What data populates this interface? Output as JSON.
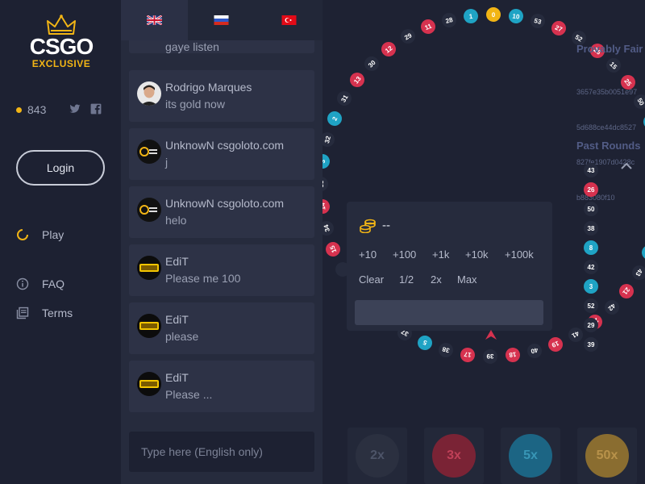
{
  "brand": {
    "main": "CSGO",
    "sub": "EXCLUSIVE"
  },
  "user": {
    "balance": "843"
  },
  "sidebar": {
    "login_label": "Login",
    "nav": [
      {
        "label": "Play",
        "icon": "spinner-icon"
      },
      {
        "label": "FAQ",
        "icon": "info-icon"
      },
      {
        "label": "Terms",
        "icon": "document-icon"
      }
    ]
  },
  "languages": [
    {
      "code": "en",
      "icon": "uk-flag-icon"
    },
    {
      "code": "ru",
      "icon": "russia-flag-icon"
    },
    {
      "code": "tr",
      "icon": "turkey-flag-icon"
    }
  ],
  "chat": {
    "partial_top_text": "gaye listen",
    "messages": [
      {
        "user": "Rodrigo Marques",
        "text": "its gold now",
        "avatar": "photo"
      },
      {
        "user": "UnknowN csgoloto.com",
        "text": "j",
        "avatar": "csgoloto"
      },
      {
        "user": "UnknowN csgoloto.com",
        "text": "helo",
        "avatar": "csgoloto"
      },
      {
        "user": "EdiT",
        "text": "Please me 100",
        "avatar": "edit"
      },
      {
        "user": "EdiT",
        "text": "please",
        "avatar": "edit"
      },
      {
        "user": "EdiT",
        "text": "Please ...",
        "avatar": "edit"
      }
    ],
    "input_placeholder": "Type here (English only)"
  },
  "provably_fair": {
    "title": "Provably Fair",
    "hash_lines": [
      "3657e35b0051e97",
      "5d688ce44dc8527",
      "827fe1907d0428c",
      "b883080f10"
    ]
  },
  "past_rounds": {
    "title": "Past Rounds",
    "values": [
      {
        "n": "43",
        "color": "#262b3d"
      },
      {
        "n": "26",
        "color": "#d6324f"
      },
      {
        "n": "50",
        "color": "#262b3d"
      },
      {
        "n": "38",
        "color": "#262b3d"
      },
      {
        "n": "8",
        "color": "#1fa3c4"
      },
      {
        "n": "42",
        "color": "#262b3d"
      },
      {
        "n": "3",
        "color": "#1fa3c4"
      },
      {
        "n": "52",
        "color": "#262b3d"
      },
      {
        "n": "29",
        "color": "#262b3d"
      },
      {
        "n": "39",
        "color": "#262b3d"
      }
    ]
  },
  "wheel": {
    "balls": [
      {
        "n": "1",
        "color": "#1fa3c4"
      },
      {
        "n": "0",
        "color": "#f2b515"
      },
      {
        "n": "10",
        "color": "#1fa3c4"
      },
      {
        "n": "53",
        "color": "#262b3d"
      },
      {
        "n": "27",
        "color": "#d6324f"
      },
      {
        "n": "52",
        "color": "#262b3d"
      },
      {
        "n": "26",
        "color": "#d6324f"
      },
      {
        "n": "15",
        "color": "#262b3d"
      },
      {
        "n": "25",
        "color": "#d6324f"
      },
      {
        "n": "50",
        "color": "#262b3d"
      },
      {
        "n": "6",
        "color": "#1fa3c4"
      },
      {
        "n": "49",
        "color": "#262b3d"
      },
      {
        "n": "",
        "color": "#1fa3c4"
      },
      {
        "n": "",
        "color": "#262b3d"
      },
      {
        "n": "",
        "color": "#262b3d"
      },
      {
        "n": "",
        "color": "#262b3d"
      },
      {
        "n": "6",
        "color": "#1fa3c4"
      },
      {
        "n": "43",
        "color": "#262b3d"
      },
      {
        "n": "21",
        "color": "#d6324f"
      },
      {
        "n": "42",
        "color": "#262b3d"
      },
      {
        "n": "20",
        "color": "#d6324f"
      },
      {
        "n": "41",
        "color": "#262b3d"
      },
      {
        "n": "19",
        "color": "#d6324f"
      },
      {
        "n": "40",
        "color": "#262b3d"
      },
      {
        "n": "18",
        "color": "#d6324f"
      },
      {
        "n": "39",
        "color": "#262b3d"
      },
      {
        "n": "17",
        "color": "#d6324f"
      },
      {
        "n": "38",
        "color": "#262b3d"
      },
      {
        "n": "5",
        "color": "#1fa3c4"
      },
      {
        "n": "37",
        "color": "#262b3d"
      },
      {
        "n": "",
        "color": "#1fa3c4"
      },
      {
        "n": "",
        "color": "#262b3d"
      },
      {
        "n": "",
        "color": "#d6324f"
      },
      {
        "n": "",
        "color": "#262b3d"
      },
      {
        "n": "15",
        "color": "#d6324f"
      },
      {
        "n": "34",
        "color": "#262b3d"
      },
      {
        "n": "14",
        "color": "#d6324f"
      },
      {
        "n": "33",
        "color": "#262b3d"
      },
      {
        "n": "3",
        "color": "#1fa3c4"
      },
      {
        "n": "32",
        "color": "#262b3d"
      },
      {
        "n": "2",
        "color": "#1fa3c4"
      },
      {
        "n": "31",
        "color": "#262b3d"
      },
      {
        "n": "13",
        "color": "#d6324f"
      },
      {
        "n": "30",
        "color": "#262b3d"
      },
      {
        "n": "12",
        "color": "#d6324f"
      },
      {
        "n": "29",
        "color": "#262b3d"
      },
      {
        "n": "11",
        "color": "#d6324f"
      },
      {
        "n": "28",
        "color": "#262b3d"
      }
    ]
  },
  "bet": {
    "amount": "--",
    "quick_buttons": [
      "+10",
      "+100",
      "+1k",
      "+10k",
      "+100k"
    ],
    "modifier_buttons": [
      "Clear",
      "1/2",
      "2x",
      "Max"
    ]
  },
  "multipliers": [
    {
      "label": "2x",
      "bg": "#2b3040",
      "fg": "#4d5468"
    },
    {
      "label": "3x",
      "bg": "#7a2335",
      "fg": "#c04058"
    },
    {
      "label": "5x",
      "bg": "#1c6584",
      "fg": "#3896b6"
    },
    {
      "label": "50x",
      "bg": "#8a6d30",
      "fg": "#b8924a"
    }
  ],
  "colors": {
    "red": "#d6324f",
    "blue": "#1fa3c4",
    "gold": "#f2b515",
    "dark": "#262b3d"
  }
}
